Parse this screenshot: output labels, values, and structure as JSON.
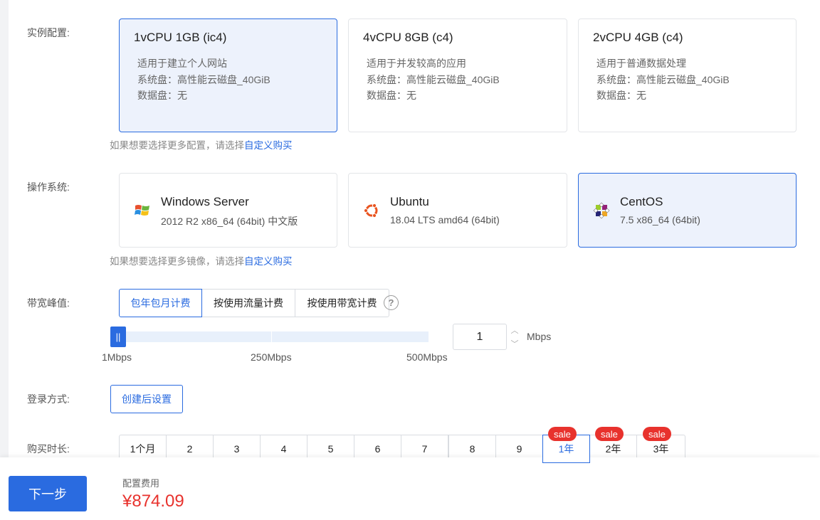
{
  "config": {
    "label": "实例配置:",
    "cards": [
      {
        "title": "1vCPU 1GB (ic4)",
        "lines": [
          "适用于建立个人网站",
          "系统盘：高性能云磁盘_40GiB",
          "数据盘：无"
        ],
        "selected": true
      },
      {
        "title": "4vCPU 8GB (c4)",
        "lines": [
          "适用于并发较高的应用",
          "系统盘：高性能云磁盘_40GiB",
          "数据盘：无"
        ],
        "selected": false
      },
      {
        "title": "2vCPU 4GB (c4)",
        "lines": [
          "适用于普通数据处理",
          "系统盘：高性能云磁盘_40GiB",
          "数据盘：无"
        ],
        "selected": false
      }
    ],
    "hint": "如果想要选择更多配置，请选择",
    "hint_link": "自定义购买"
  },
  "os": {
    "label": "操作系统:",
    "cards": [
      {
        "name": "Windows Server",
        "version": "2012 R2 x86_64 (64bit) 中文版",
        "icon": "windows-icon",
        "selected": false
      },
      {
        "name": "Ubuntu",
        "version": "18.04 LTS amd64 (64bit)",
        "icon": "ubuntu-icon",
        "selected": false
      },
      {
        "name": "CentOS",
        "version": "7.5 x86_64 (64bit)",
        "icon": "centos-icon",
        "selected": true
      }
    ],
    "hint": "如果想要选择更多镜像，请选择",
    "hint_link": "自定义购买"
  },
  "bandwidth": {
    "label": "带宽峰值:",
    "tabs": [
      "包年包月计费",
      "按使用流量计费",
      "按使用带宽计费"
    ],
    "active_tab": 0,
    "help": "?",
    "slider_min_label": "1Mbps",
    "slider_mid_label": "250Mbps",
    "slider_max_label": "500Mbps",
    "thumb_glyph": "||",
    "value": "1",
    "unit": "Mbps"
  },
  "login": {
    "label": "登录方式:",
    "button": "创建后设置"
  },
  "duration": {
    "label": "购买时长:",
    "options": [
      "1个月",
      "2",
      "3",
      "4",
      "5",
      "6",
      "7",
      "8",
      "9",
      "1年",
      "2年",
      "3年"
    ],
    "active": 9,
    "sale_badge": "sale"
  },
  "footer": {
    "next": "下一步",
    "fee_label": "配置费用",
    "fee_value": "¥874.09"
  },
  "colors": {
    "accent": "#2a6be0",
    "price": "#e8322d",
    "sale": "#e8322d"
  }
}
